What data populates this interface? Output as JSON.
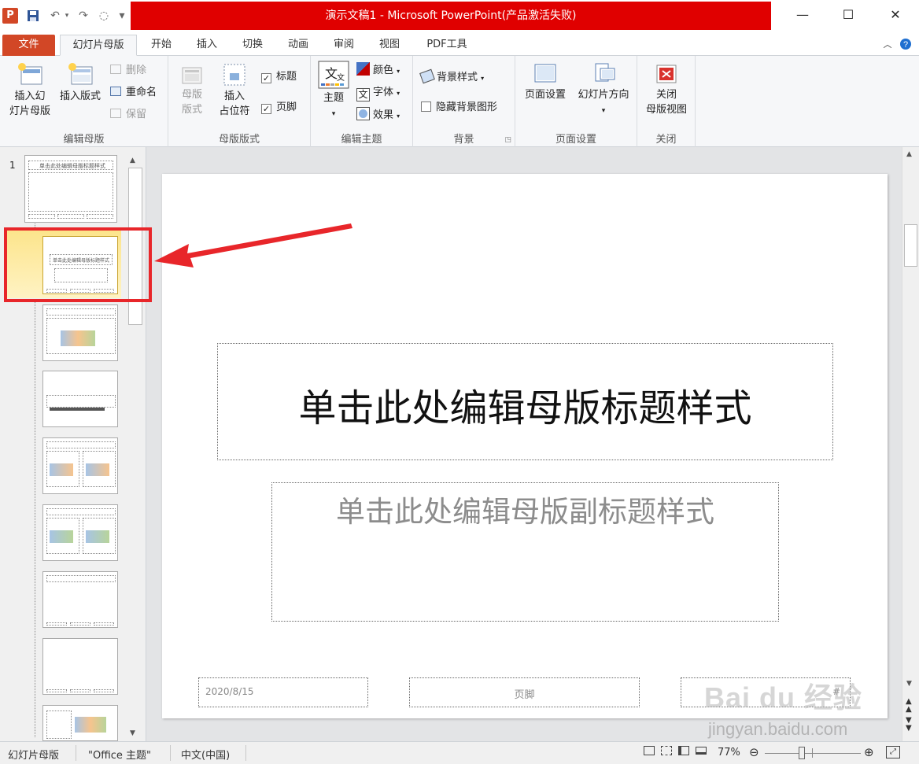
{
  "titlebar": {
    "app_icon": "P",
    "title": "演示文稿1 - Microsoft PowerPoint(产品激活失败)",
    "qat_icons": [
      "save-icon",
      "undo-icon",
      "redo-icon",
      "repeat-icon",
      "customize-icon"
    ],
    "minimize": "—",
    "maximize": "☐",
    "close": "✕"
  },
  "tabs": [
    "文件",
    "幻灯片母版",
    "开始",
    "插入",
    "切换",
    "动画",
    "审阅",
    "视图",
    "PDF工具"
  ],
  "ribbon": {
    "edit_master": {
      "label": "编辑母版",
      "insert_master_l1": "插入幻",
      "insert_master_l2": "灯片母版",
      "insert_layout": "插入版式",
      "delete": "删除",
      "rename": "重命名",
      "preserve": "保留"
    },
    "master_layout": {
      "label": "母版版式",
      "master_layout_l1": "母版",
      "master_layout_l2": "版式",
      "insert_placeholder_l1": "插入",
      "insert_placeholder_l2": "占位符",
      "title_chk": "标题",
      "footer_chk": "页脚"
    },
    "edit_theme": {
      "label": "编辑主题",
      "theme": "主题",
      "colors": "颜色",
      "fonts": "字体",
      "effects": "效果"
    },
    "background": {
      "label": "背景",
      "bg_styles": "背景样式",
      "hide_bg": "隐藏背景图形"
    },
    "page_setup": {
      "label": "页面设置",
      "page_setup": "页面设置",
      "orientation": "幻灯片方向"
    },
    "close": {
      "label": "关闭",
      "close_l1": "关闭",
      "close_l2": "母版视图"
    }
  },
  "thumbnails": {
    "slide_number": "1",
    "master_title": "单击此处编辑母版标题样式",
    "layout_title": "单击此处编辑母版标题样式"
  },
  "slide": {
    "title": "单击此处编辑母版标题样式",
    "subtitle": "单击此处编辑母版副标题样式",
    "date": "2020/8/15",
    "footer": "页脚",
    "number": "#"
  },
  "status": {
    "view": "幻灯片母版",
    "theme": "\"Office 主题\"",
    "language": "中文(中国)",
    "zoom": "77%"
  },
  "watermark": {
    "brand": "Bai du 经验",
    "url": "jingyan.baidu.com"
  },
  "colors": {
    "accent": "#d24726",
    "title_bar_red": "#e00000",
    "annotation": "#e8262a",
    "selected_thumb": "#fce48a"
  }
}
